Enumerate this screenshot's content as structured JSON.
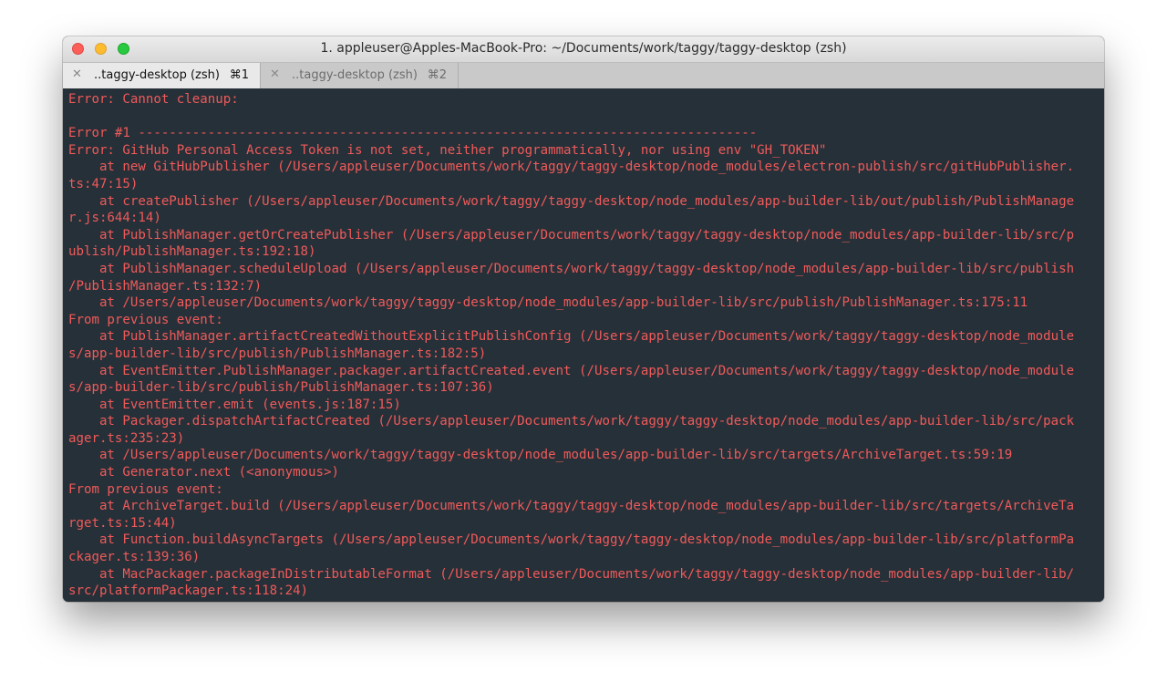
{
  "window": {
    "title": "1. appleuser@Apples-MacBook-Pro: ~/Documents/work/taggy/taggy-desktop (zsh)"
  },
  "tabs": [
    {
      "close_glyph": "✕",
      "label": "..taggy-desktop (zsh)",
      "shortcut": "⌘1"
    },
    {
      "close_glyph": "✕",
      "label": "..taggy-desktop (zsh)",
      "shortcut": "⌘2"
    }
  ],
  "colors": {
    "terminal_background": "#263038",
    "terminal_text": "#f05a5a"
  },
  "terminal": {
    "lines": [
      "Error: Cannot cleanup:",
      "",
      "Error #1 --------------------------------------------------------------------------------",
      "Error: GitHub Personal Access Token is not set, neither programmatically, nor using env \"GH_TOKEN\"",
      "    at new GitHubPublisher (/Users/appleuser/Documents/work/taggy/taggy-desktop/node_modules/electron-publish/src/gitHubPublisher.",
      "ts:47:15)",
      "    at createPublisher (/Users/appleuser/Documents/work/taggy/taggy-desktop/node_modules/app-builder-lib/out/publish/PublishManage",
      "r.js:644:14)",
      "    at PublishManager.getOrCreatePublisher (/Users/appleuser/Documents/work/taggy/taggy-desktop/node_modules/app-builder-lib/src/p",
      "ublish/PublishManager.ts:192:18)",
      "    at PublishManager.scheduleUpload (/Users/appleuser/Documents/work/taggy/taggy-desktop/node_modules/app-builder-lib/src/publish",
      "/PublishManager.ts:132:7)",
      "    at /Users/appleuser/Documents/work/taggy/taggy-desktop/node_modules/app-builder-lib/src/publish/PublishManager.ts:175:11",
      "From previous event:",
      "    at PublishManager.artifactCreatedWithoutExplicitPublishConfig (/Users/appleuser/Documents/work/taggy/taggy-desktop/node_module",
      "s/app-builder-lib/src/publish/PublishManager.ts:182:5)",
      "    at EventEmitter.PublishManager.packager.artifactCreated.event (/Users/appleuser/Documents/work/taggy/taggy-desktop/node_module",
      "s/app-builder-lib/src/publish/PublishManager.ts:107:36)",
      "    at EventEmitter.emit (events.js:187:15)",
      "    at Packager.dispatchArtifactCreated (/Users/appleuser/Documents/work/taggy/taggy-desktop/node_modules/app-builder-lib/src/pack",
      "ager.ts:235:23)",
      "    at /Users/appleuser/Documents/work/taggy/taggy-desktop/node_modules/app-builder-lib/src/targets/ArchiveTarget.ts:59:19",
      "    at Generator.next (<anonymous>)",
      "From previous event:",
      "    at ArchiveTarget.build (/Users/appleuser/Documents/work/taggy/taggy-desktop/node_modules/app-builder-lib/src/targets/ArchiveTa",
      "rget.ts:15:44)",
      "    at Function.buildAsyncTargets (/Users/appleuser/Documents/work/taggy/taggy-desktop/node_modules/app-builder-lib/src/platformPa",
      "ckager.ts:139:36)",
      "    at MacPackager.packageInDistributableFormat (/Users/appleuser/Documents/work/taggy/taggy-desktop/node_modules/app-builder-lib/",
      "src/platformPackager.ts:118:24)"
    ]
  }
}
